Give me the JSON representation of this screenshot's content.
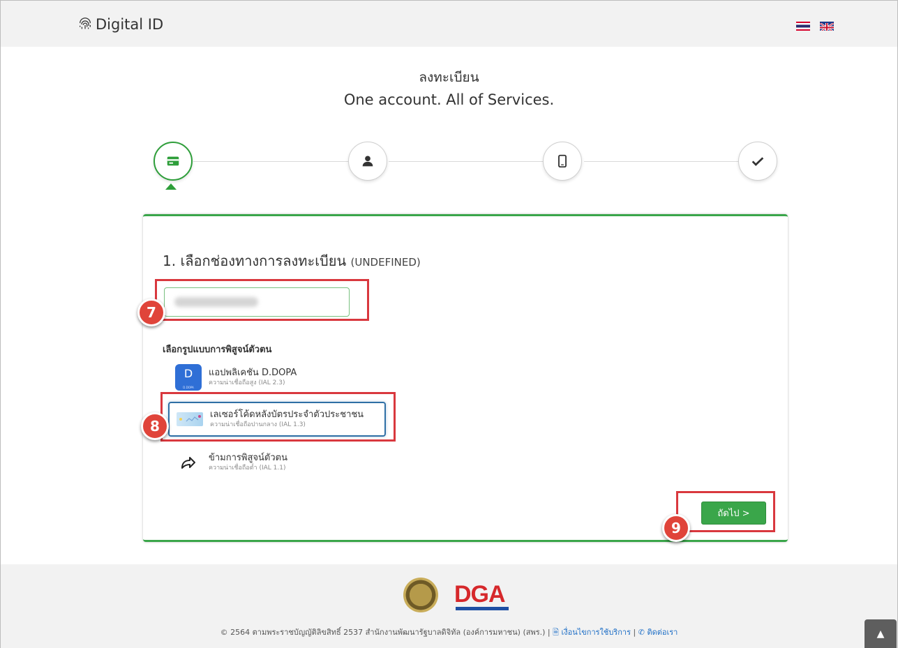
{
  "header": {
    "brand": "Digital ID",
    "languages": [
      "th-flag-icon",
      "uk-flag-icon"
    ]
  },
  "titles": {
    "th": "ลงทะเบียน",
    "en": "One account. All of Services."
  },
  "stepper": {
    "steps": [
      "card-icon",
      "user-icon",
      "mobile-icon",
      "check-icon"
    ],
    "active_index": 0,
    "accent_color": "#2e9e3a"
  },
  "card": {
    "section_title": "1. เลือกช่องทางการลงทะเบียน",
    "section_hint": "(UNDEFINED)",
    "id_input_value": "",
    "method_label": "เลือกรูปแบบการพิสูจน์ตัวตน",
    "options": [
      {
        "main": "แอปพลิเคชัน D.DOPA",
        "sub": "ความน่าเชื่อถือสูง (IAL 2.3)",
        "icon_text": "D",
        "icon_sub": "D.DOPA",
        "selected": false
      },
      {
        "main": "เลเซอร์โค้ดหลังบัตรประจำตัวประชาชน",
        "sub": "ความน่าเชื่อถือปานกลาง (IAL 1.3)",
        "selected": true
      },
      {
        "main": "ข้ามการพิสูจน์ตัวตน",
        "sub": "ความน่าเชื่อถือต่ำ (IAL 1.1)",
        "selected": false
      }
    ],
    "next_label": "ถัดไป >"
  },
  "annotations": [
    "7",
    "8",
    "9"
  ],
  "footer": {
    "logo_text": "DGA",
    "copyright": "© 2564 ตามพระราชบัญญัติลิขสิทธิ์ 2537 สำนักงานพัฒนารัฐบาลดิจิทัล (องค์การมหาชน) (สพร.) |",
    "terms_link": "เงื่อนไขการใช้บริการ",
    "separator": "|",
    "contact_link": "ติดต่อเรา"
  },
  "colors": {
    "green": "#3aa64a",
    "annotation_red": "#d9383e",
    "selected_border": "#2f6fa5"
  }
}
